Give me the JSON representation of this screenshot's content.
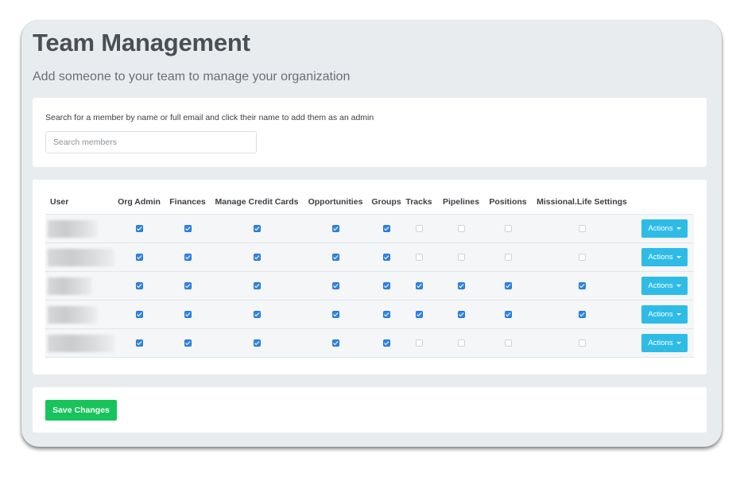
{
  "header": {
    "title": "Team Management",
    "subtitle": "Add someone to your team to manage your organization"
  },
  "search": {
    "help_text": "Search for a member by name or full email and click their name to add them as an admin",
    "placeholder": "Search members",
    "value": ""
  },
  "table": {
    "columns": [
      "User",
      "Org Admin",
      "Finances",
      "Manage Credit Cards",
      "Opportunities",
      "Groups",
      "Tracks",
      "Pipelines",
      "Positions",
      "Missional.Life Settings"
    ],
    "rows": [
      {
        "user": "",
        "permissions": [
          true,
          true,
          true,
          true,
          true,
          false,
          false,
          false,
          false
        ],
        "action_label": "Actions"
      },
      {
        "user": "",
        "permissions": [
          true,
          true,
          true,
          true,
          true,
          false,
          false,
          false,
          false
        ],
        "action_label": "Actions"
      },
      {
        "user": "",
        "permissions": [
          true,
          true,
          true,
          true,
          true,
          true,
          true,
          true,
          true
        ],
        "action_label": "Actions"
      },
      {
        "user": "",
        "permissions": [
          true,
          true,
          true,
          true,
          true,
          true,
          true,
          true,
          true
        ],
        "action_label": "Actions"
      },
      {
        "user": "",
        "permissions": [
          true,
          true,
          true,
          true,
          true,
          false,
          false,
          false,
          false
        ],
        "action_label": "Actions"
      }
    ]
  },
  "footer": {
    "save_label": "Save Changes"
  },
  "colors": {
    "checkbox_checked": "#2f86e6",
    "actions_button": "#2ebce6",
    "save_button": "#16c45b",
    "page_background": "#e9ecef"
  },
  "icons": {
    "actions_dropdown": "caret-down-icon"
  }
}
